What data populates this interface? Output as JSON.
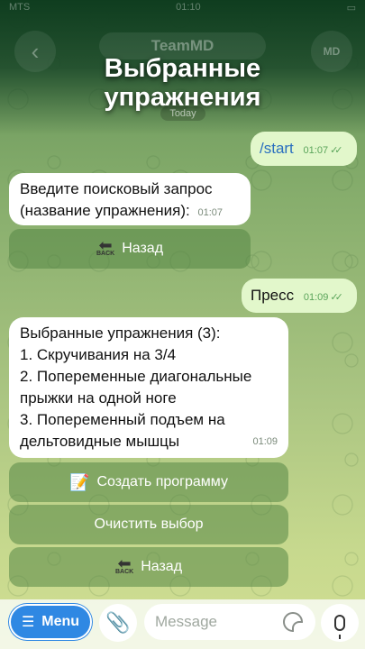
{
  "status": {
    "carrier": "MTS",
    "time": "01:10",
    "battery": ""
  },
  "header": {
    "back_icon": "chevron-left-icon",
    "chat_name": "TeamMD",
    "avatar_initials": "MD",
    "overlay_title": "Выбранные упражнения",
    "date_chip": "Today"
  },
  "messages": [
    {
      "dir": "out",
      "text": "/start",
      "time": "01:07",
      "status": "read"
    },
    {
      "dir": "in",
      "text": "Введите поисковый запрос (название упражнения):",
      "time": "01:07",
      "buttons": [
        {
          "label": "Назад",
          "icon": "back-arrow-icon",
          "icon_text": "BACK"
        }
      ]
    },
    {
      "dir": "out",
      "text": "Пресс",
      "time": "01:09",
      "status": "read"
    },
    {
      "dir": "in",
      "lines": [
        "Выбранные упражнения (3):",
        "1. Скручивания на 3/4",
        "2. Попеременные диагональные",
        "прыжки на одной ноге",
        "3. Попеременный подъем на",
        "дельтовидные мышцы"
      ],
      "time": "01:09",
      "buttons": [
        {
          "label": "Создать программу",
          "icon": "memo-icon"
        },
        {
          "label": "Очистить выбор"
        },
        {
          "label": "Назад",
          "icon": "back-arrow-icon",
          "icon_text": "BACK"
        }
      ]
    }
  ],
  "input": {
    "menu_label": "Menu",
    "attach_icon": "paperclip-icon",
    "placeholder": "Message",
    "sticker_icon": "sticker-icon",
    "mic_icon": "microphone-icon"
  },
  "colors": {
    "accent": "#2f88e3",
    "outgoing": "#e2f7cb",
    "incoming": "#ffffff",
    "keyboard_button": "#5f8f55"
  }
}
